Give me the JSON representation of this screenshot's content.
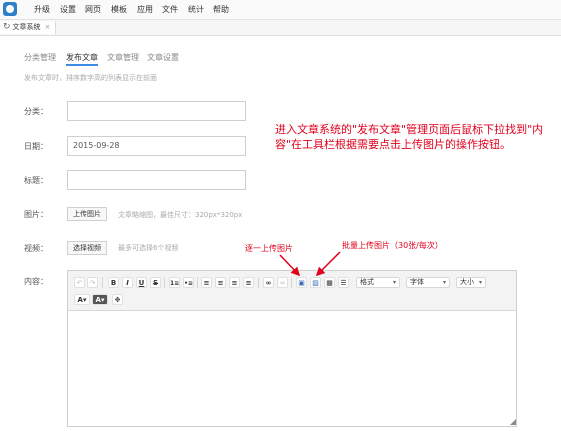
{
  "topmenu": {
    "items": [
      "升级",
      "设置",
      "网页",
      "模板",
      "应用",
      "文件",
      "统计",
      "帮助"
    ]
  },
  "tab": {
    "label": "文章系统",
    "close": "×"
  },
  "subtabs": [
    "分类管理",
    "发布文章",
    "文章管理",
    "文章设置"
  ],
  "active_subtab": 1,
  "hint": "发布文章时，排序数字高的列表显示在前面",
  "form": {
    "category_label": "分类：",
    "date_label": "日期：",
    "date_value": "2015-09-28",
    "title_label": "标题：",
    "image_label": "图片：",
    "image_button": "上传图片",
    "image_note": "文章略缩图，最佳尺寸：320px*320px",
    "video_label": "视频：",
    "video_button": "选择视频",
    "video_note": "最多可选择6个视频",
    "content_label": "内容："
  },
  "editor": {
    "style_dropdown": "格式",
    "font_dropdown": "字体",
    "size_dropdown": "大小"
  },
  "annotations": {
    "main": "进入文章系统的\"发布文章\"管理页面后鼠标下拉找到\"内容\"在工具栏根据需要点击上传图片的操作按钮。",
    "single_upload": "逐一上传图片",
    "batch_upload": "批量上传图片（30张/每次）",
    "color": "#e0001b"
  }
}
